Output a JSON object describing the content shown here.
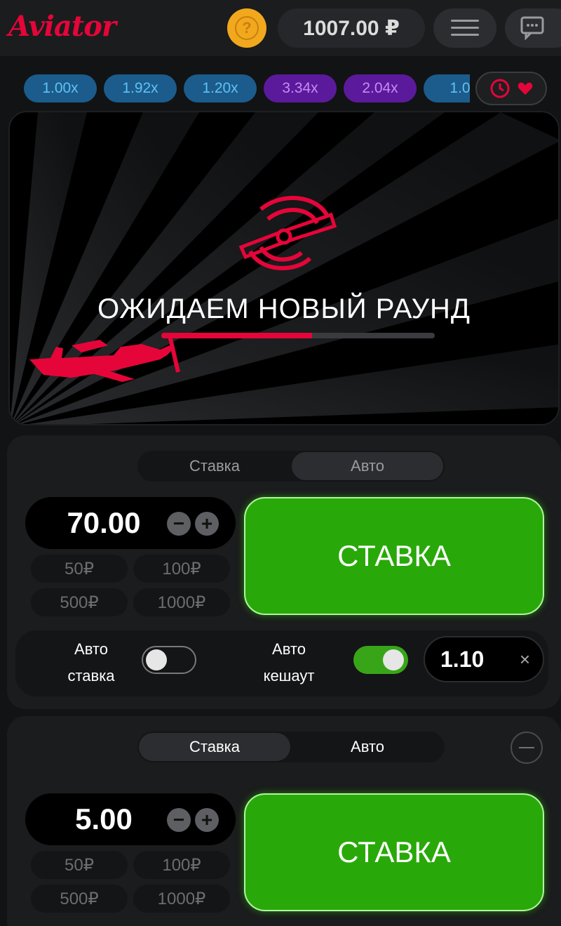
{
  "header": {
    "logo": "Aviator",
    "help_icon": "?",
    "balance": "1007.00 ₽"
  },
  "history": {
    "multipliers": [
      {
        "value": "1.00x",
        "color": "blue"
      },
      {
        "value": "1.92x",
        "color": "blue"
      },
      {
        "value": "1.20x",
        "color": "blue"
      },
      {
        "value": "3.34x",
        "color": "purple"
      },
      {
        "value": "2.04x",
        "color": "purple"
      },
      {
        "value": "1.0",
        "color": "blue"
      }
    ]
  },
  "game": {
    "status_text": "ОЖИДАЕМ НОВЫЙ РАУНД",
    "progress": 0.55
  },
  "bet_panel_1": {
    "tabs": [
      "Ставка",
      "Авто"
    ],
    "active_tab": "Авто",
    "amount": "70.00",
    "quick_amounts": [
      "50₽",
      "100₽",
      "500₽",
      "1000₽"
    ],
    "bet_button": "СТАВКА",
    "auto_bet_label_1": "Авто",
    "auto_bet_label_2": "ставка",
    "auto_bet_enabled": false,
    "auto_cashout_label_1": "Авто",
    "auto_cashout_label_2": "кешаут",
    "auto_cashout_enabled": true,
    "auto_cashout_value": "1.10",
    "clear_icon": "×"
  },
  "bet_panel_2": {
    "tabs": [
      "Ставка",
      "Авто"
    ],
    "active_tab": "Ставка",
    "amount": "5.00",
    "quick_amounts": [
      "50₽",
      "100₽",
      "500₽",
      "1000₽"
    ],
    "bet_button": "СТАВКА"
  },
  "colors": {
    "brand_red": "#e50539",
    "bet_green": "#28a909",
    "pill_blue": "#5fc2f2",
    "pill_purple": "#c98af5"
  }
}
